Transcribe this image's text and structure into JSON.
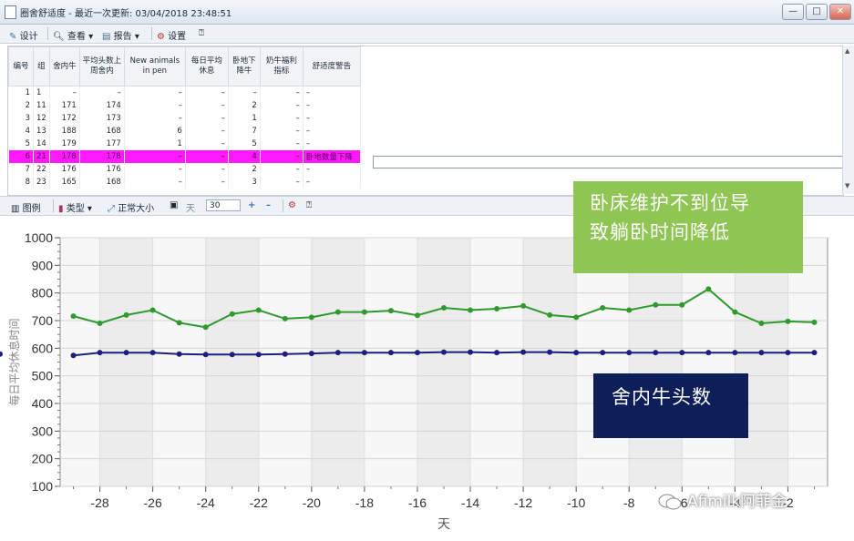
{
  "window": {
    "title": "圈舍舒适度 - 最近一次更新: 03/04/2018 23:48:51",
    "buttons": [
      "—",
      "□",
      "✕"
    ]
  },
  "toolbar": {
    "design_label": "设计",
    "view_label": "查看",
    "report_label": "报告",
    "settings_label": "设置"
  },
  "table": {
    "headers": [
      "编号",
      "组",
      "舍内牛",
      "平均头数上周舍内",
      "New animals in pen",
      "每日平均休息",
      "卧地下降牛",
      "奶牛福利指标",
      "舒适度警告"
    ],
    "rows": [
      [
        "1",
        "1",
        "–",
        "–",
        "–",
        "–",
        "–",
        "–",
        "–"
      ],
      [
        "2",
        "11",
        "171",
        "174",
        "–",
        "–",
        "2",
        "–",
        "–"
      ],
      [
        "3",
        "12",
        "172",
        "173",
        "–",
        "–",
        "1",
        "–",
        "–"
      ],
      [
        "4",
        "13",
        "188",
        "168",
        "6",
        "–",
        "7",
        "–",
        "–"
      ],
      [
        "5",
        "14",
        "179",
        "177",
        "1",
        "–",
        "5",
        "–",
        "–"
      ],
      [
        "6",
        "21",
        "178",
        "178",
        "–",
        "–",
        "4",
        "–",
        "卧地数量下降"
      ],
      [
        "7",
        "22",
        "176",
        "176",
        "–",
        "–",
        "2",
        "–",
        "–"
      ],
      [
        "8",
        "23",
        "165",
        "168",
        "–",
        "–",
        "3",
        "–",
        "–"
      ]
    ],
    "highlight_row_index": 5,
    "highlight_color": "#ff19ff"
  },
  "chart_toolbar": {
    "legend_label": "图例",
    "type_label": "类型",
    "normal_size_label": "正常大小",
    "days_label": "天",
    "days_value": "30",
    "plus": "+",
    "minus": "–"
  },
  "chart_data": {
    "type": "line",
    "xlabel": "天",
    "ylabel": "每日平均休息时间",
    "xlim": [
      -29.5,
      -0.5
    ],
    "ylim": [
      100,
      1000
    ],
    "yticks": [
      100,
      200,
      300,
      400,
      500,
      600,
      700,
      800,
      900,
      1000
    ],
    "xticks": [
      -28,
      -26,
      -24,
      -22,
      -20,
      -18,
      -16,
      -14,
      -12,
      -10,
      -8,
      -6,
      -4,
      -2
    ],
    "grid": true,
    "x": [
      -29,
      -28,
      -27,
      -26,
      -25,
      -24,
      -23,
      -22,
      -21,
      -20,
      -19,
      -18,
      -17,
      -16,
      -15,
      -14,
      -13,
      -12,
      -11,
      -10,
      -9,
      -8,
      -7,
      -6,
      -5,
      -4,
      -3,
      -2,
      -1
    ],
    "series": [
      {
        "color": "#2e9a2e",
        "values": [
          716,
          690,
          720,
          738,
          692,
          676,
          724,
          738,
          707,
          712,
          731,
          731,
          736,
          719,
          746,
          738,
          743,
          753,
          720,
          712,
          746,
          738,
          757,
          757,
          814,
          731,
          690,
          697,
          694,
          null
        ]
      },
      {
        "color": "#1a1f80",
        "values": [
          574,
          584,
          584,
          584,
          579,
          577,
          577,
          577,
          579,
          581,
          584,
          584,
          584,
          584,
          586,
          586,
          584,
          586,
          586,
          584,
          584,
          584,
          584,
          584,
          584,
          584,
          584,
          584,
          584,
          579
        ]
      }
    ]
  },
  "annotations": {
    "green_callout": [
      "卧床维护不到位导",
      "致躺卧时间降低"
    ],
    "navy_callout": "舍内牛头数",
    "green_color": "#8fc553",
    "navy_color": "#0d1e59"
  },
  "watermark": {
    "text": "Afimilk阿菲金"
  }
}
